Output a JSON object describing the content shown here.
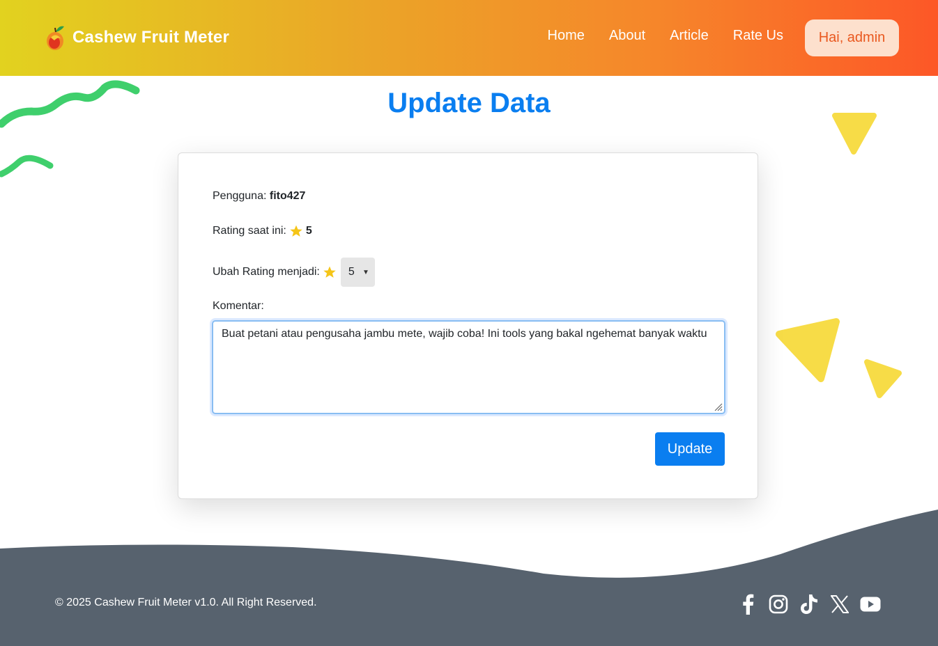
{
  "navbar": {
    "brand": "Cashew Fruit Meter",
    "links": [
      "Home",
      "About",
      "Article",
      "Rate Us"
    ],
    "user_button": "Hai, admin"
  },
  "page": {
    "title": "Update Data"
  },
  "form": {
    "user_label": "Pengguna:",
    "user_value": "fito427",
    "current_rating_label": "Rating saat ini:",
    "current_rating_value": "5",
    "change_rating_label": "Ubah Rating menjadi:",
    "change_rating_selected": "5",
    "comment_label": "Komentar:",
    "comment_value": "Buat petani atau pengusaha jambu mete, wajib coba! Ini tools yang bakal ngehemat banyak waktu",
    "submit_label": "Update"
  },
  "footer": {
    "copyright": "© 2025 Cashew Fruit Meter v1.0. All Right Reserved.",
    "socials": [
      "facebook-icon",
      "instagram-icon",
      "tiktok-icon",
      "x-icon",
      "youtube-icon"
    ]
  },
  "colors": {
    "accent_blue": "#0a7ef0",
    "star": "#f5c518",
    "footer": "#57626e",
    "deco_green": "#3fcf6c",
    "deco_yellow": "#f7dc47"
  }
}
